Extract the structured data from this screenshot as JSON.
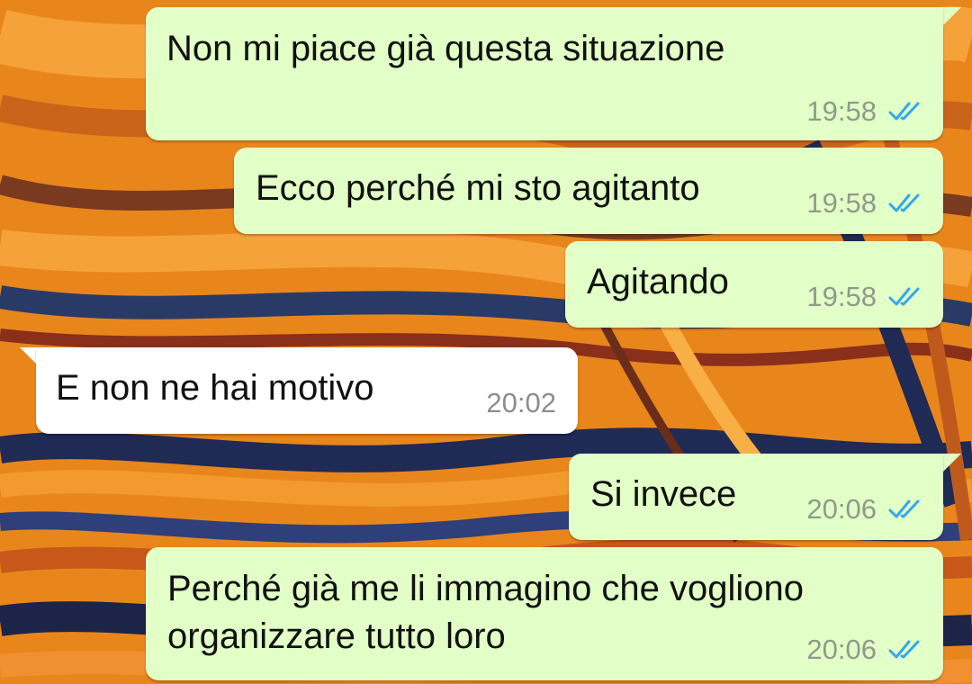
{
  "colors": {
    "outgoing_bubble": "#e2ffc7",
    "incoming_bubble": "#ffffff",
    "read_ticks": "#34a8eb",
    "timestamp": "#8f9a8a",
    "wallpaper_base": "#e8861c"
  },
  "messages": [
    {
      "direction": "outgoing",
      "text": "Non mi piace già questa situazione",
      "time": "19:58",
      "status_icon": "double-check-read-icon"
    },
    {
      "direction": "outgoing",
      "text": "Ecco perché mi sto agitanto",
      "time": "19:58",
      "status_icon": "double-check-read-icon"
    },
    {
      "direction": "outgoing",
      "text": "Agitando",
      "time": "19:58",
      "status_icon": "double-check-read-icon"
    },
    {
      "direction": "incoming",
      "text": "E non ne hai motivo",
      "time": "20:02"
    },
    {
      "direction": "outgoing",
      "text": "Si invece",
      "time": "20:06",
      "status_icon": "double-check-read-icon"
    },
    {
      "direction": "outgoing",
      "text": "Perché già me li immagino che vogliono\norganizzare tutto loro",
      "time": "20:06",
      "status_icon": "double-check-read-icon"
    }
  ]
}
